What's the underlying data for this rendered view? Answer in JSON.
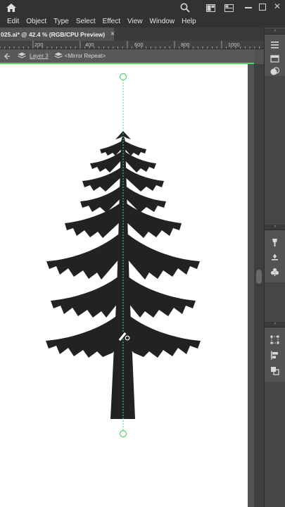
{
  "menu": {
    "items": [
      "Edit",
      "Object",
      "Type",
      "Select",
      "Effect",
      "View",
      "Window",
      "Help"
    ]
  },
  "document": {
    "tab_title": "025.ai* @ 42.4 % (RGB/CPU Preview)",
    "close_glyph": "×"
  },
  "ruler": {
    "labels": [
      "200",
      "400",
      "600",
      "800",
      "1000"
    ]
  },
  "isolation": {
    "layer": "Layer 3",
    "group": "<Mirror Repeat>"
  },
  "icons": {
    "home": "home-icon",
    "search": "search-icon",
    "arrange": "arrange-documents-icon",
    "panels": "panels-icon",
    "dock": [
      "properties-icon",
      "layers-icon",
      "appearance-icon",
      "brushes-icon",
      "symbols-icon",
      "align-icon",
      "transform-icon",
      "pathfinder-icon"
    ]
  },
  "colors": {
    "accent_green": "#4cd964",
    "guide_green": "#5fd16a",
    "artwork": "#222222"
  }
}
